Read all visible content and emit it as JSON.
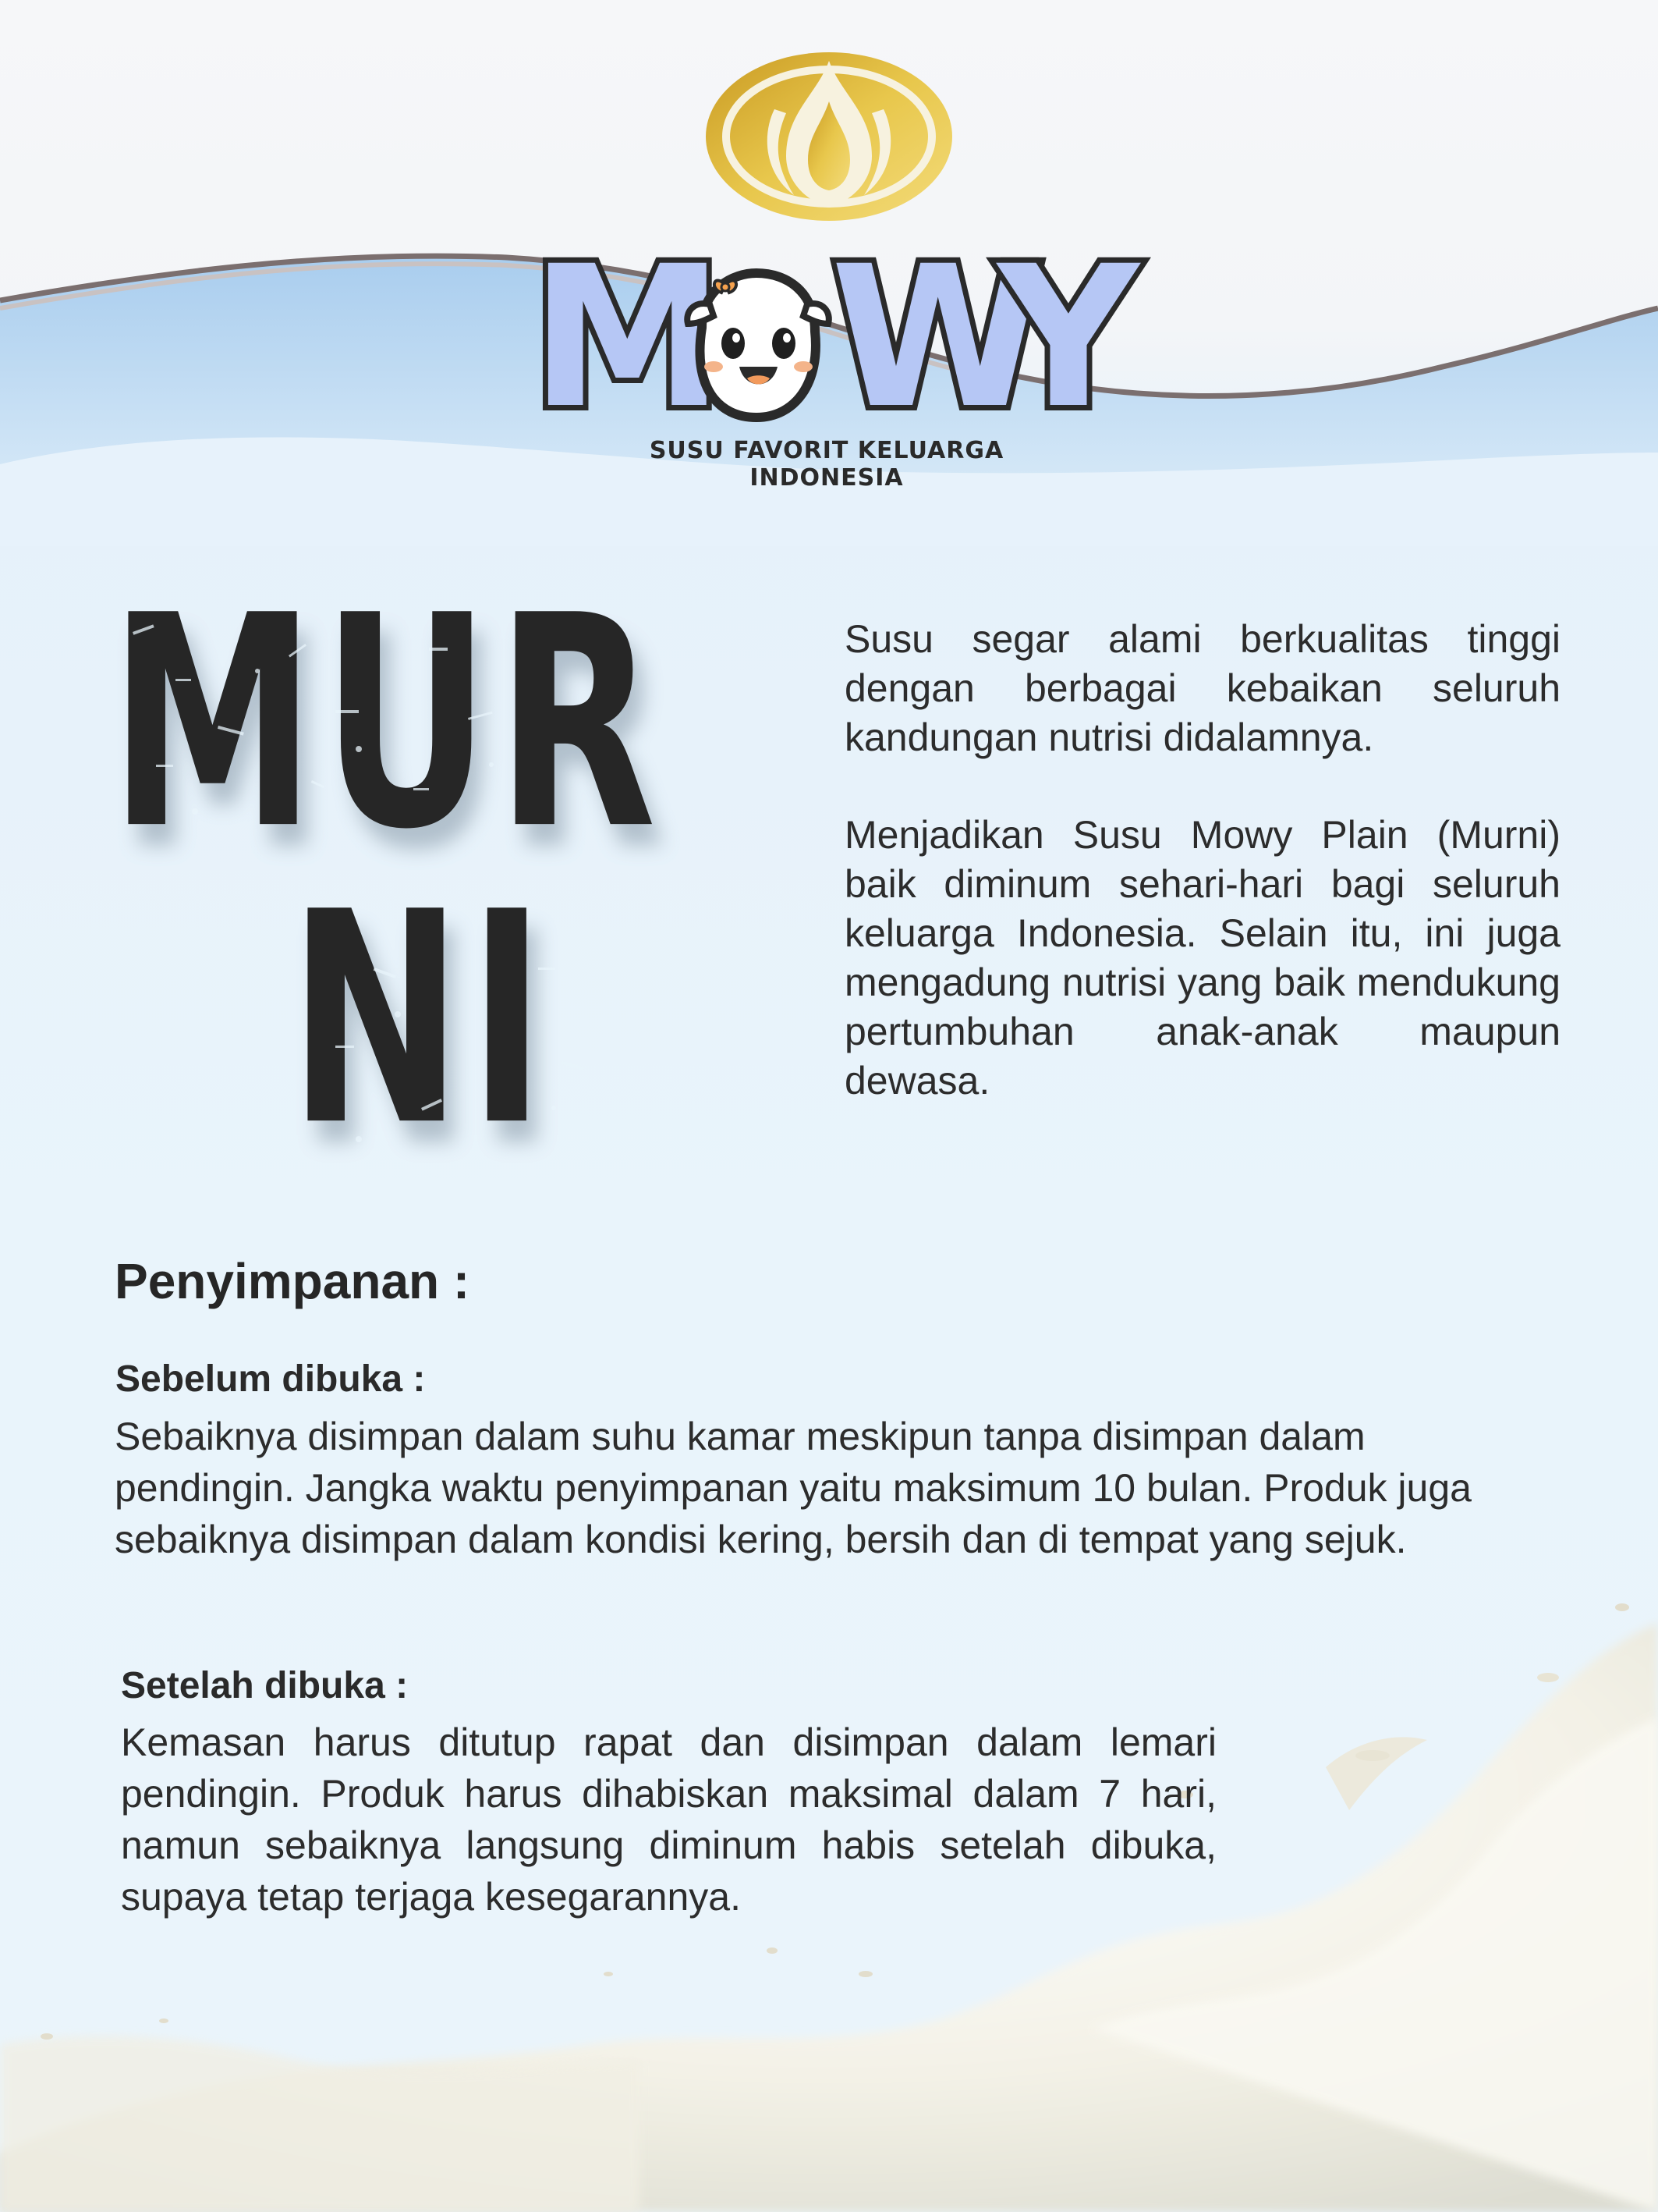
{
  "brand": {
    "name": "MOWY",
    "tagline": "SUSU FAVORIT KELUARGA INDONESIA"
  },
  "product_title": {
    "line1": "MUR",
    "line2": "NI"
  },
  "intro": {
    "paragraph1": "Susu segar alami berkualitas tinggi dengan berbagai kebaikan seluruh kandungan nutrisi didalamnya.",
    "paragraph2": "Menjadikan Susu Mowy Plain (Murni) baik diminum sehari-hari bagi seluruh keluarga Indonesia. Selain itu, ini juga mengadung nutrisi yang baik mendukung pertumbuhan anak-anak maupun dewasa."
  },
  "storage": {
    "heading": "Penyimpanan :",
    "before_open": {
      "heading": "Sebelum dibuka :",
      "text": "Sebaiknya disimpan dalam suhu kamar meskipun tanpa disimpan dalam pendingin. Jangka waktu penyimpanan yaitu maksimum 10 bulan. Produk juga sebaiknya disimpan dalam kondisi kering, bersih dan di tempat yang sejuk."
    },
    "after_open": {
      "heading": "Setelah dibuka :",
      "text": "Kemasan harus ditutup rapat dan disimpan dalam lemari pendingin. Produk harus dihabiskan maksimal dalam 7 hari, namun sebaiknya langsung diminum habis setelah dibuka, supaya tetap terjaga kesegarannya."
    }
  },
  "colors": {
    "background_top": "#f4f6f9",
    "background_light_blue": "#e7f2fb",
    "wave_blue": "#bcd8f0",
    "wave_outline": "#7b6f6f",
    "emblem_gold": "#d9b23a",
    "brand_letter_fill": "#b6c7f5",
    "text_dark": "#2c2c2c",
    "milk_white": "#f5f3ea"
  },
  "icons": {
    "emblem": "gold-drop-emblem-icon",
    "mascot": "cow-mascot-icon",
    "decoration": "milk-splash"
  }
}
